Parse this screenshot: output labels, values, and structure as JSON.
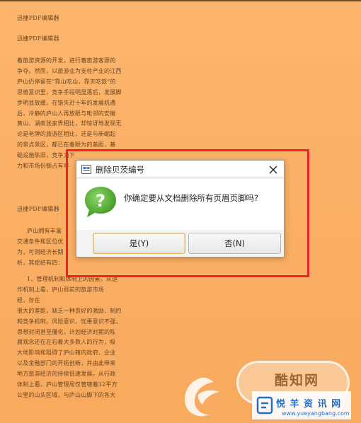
{
  "document": {
    "header1": "迅捷PDF编辑器",
    "header2": "迅捷PDF编辑器",
    "paragraph1": [
      "着旅游资源的开发，进行着旅游客源的",
      "争夺。然而，以旅游业为支柱产业的江西",
      "庐山仍停留在“靠山吃山，靠天吃饭”的",
      "思维意识里，竞争手段明显落后，发展脚",
      "步明显放缓。在错失近十年的发展机遇",
      "后，冷静的庐山人再放眼与毗邻的安徽",
      "黄山、湖南张家界相比，却惊讶地发现无",
      "论是老牌的旅游区相比，还是与新崛起",
      "的景点景区，都已在着眼为的差距，基",
      "础设施陈旧，竞争力下",
      "力和市场份额占有率"
    ],
    "header3": "迅捷PDF编辑器",
    "paragraph2": [
      "庐山拥有丰富",
      "交通条件和区位优",
      "为，可则经济长期",
      "析，其症结有四："
    ],
    "paragraph3": [
      "1、管理机制和体制上的因素。从运",
      "作机制上看，庐山目前的旅游市场",
      "经，存在",
      "很大的差距，缺乏一种良好的激励、制约",
      "和竞争机制，风险意识、忧患意识不强，",
      "思想封闭甚至僵化，计划经济时期的陈",
      "腐观念还在左右着大多数人的行为，极",
      "大地影响和阻碍了庐山辖内政府、企业",
      "以及金融部门的开拓创新，并由此带来",
      "地方旅游经济的持续低速发展。从行政",
      "体制上看，庐山管理局仅管辖着32平方",
      "公里的山头区域，与庐山山脚下的各大"
    ]
  },
  "dialog": {
    "title": "删除贝茨编号",
    "message": "你确定要从文档删除所有页眉页脚吗?",
    "yes_label": "是(Y)",
    "no_label": "否(N)"
  },
  "watermark": {
    "oval_text": "酷知网",
    "site_name": "悦 羊 资 讯 网",
    "site_url": "www.yueyangbang.com"
  },
  "icons": {
    "title": "dialog-app-icon",
    "question": "question-bubble-icon",
    "close": "close-icon"
  },
  "colors": {
    "page_bg": "#fbb36a",
    "highlight": "#e8262a",
    "question_green": "#5bb13a"
  }
}
